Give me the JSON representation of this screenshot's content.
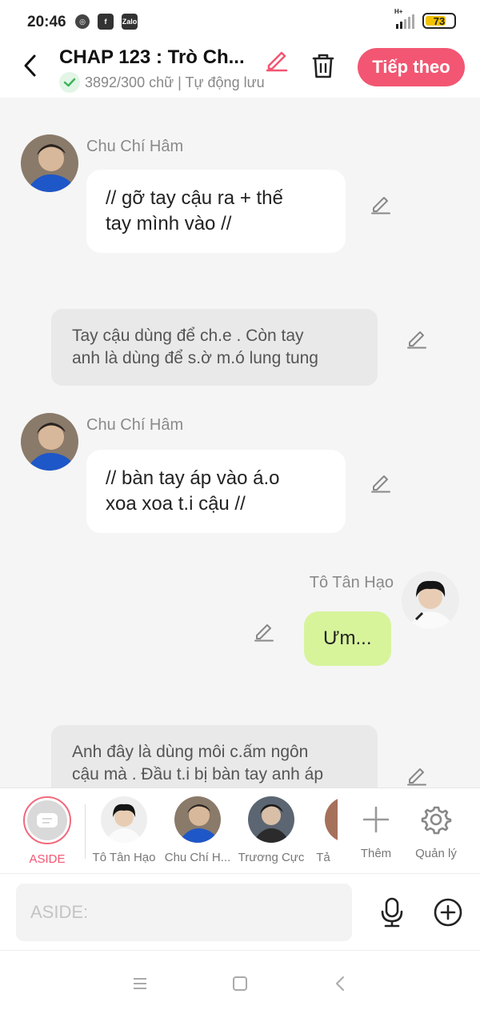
{
  "status_bar": {
    "time": "20:46",
    "network": "H+",
    "battery": "73",
    "battery_level": 0.73,
    "app_icons": [
      "target-icon",
      "facebook-icon",
      "zalo-icon"
    ]
  },
  "header": {
    "title": "CHAP 123 : Trò Ch...",
    "word_count": "3892/300 chữ | Tự động lưu",
    "next_label": "Tiếp theo",
    "accent": "#f25672"
  },
  "messages": [
    {
      "type": "left",
      "sender": "Chu Chí Hâm",
      "text_lines": [
        "// gỡ tay cậu ra + thế",
        "tay mình vào //"
      ]
    },
    {
      "type": "aside",
      "text_lines": [
        "Tay cậu dùng để ch.e . Còn tay",
        "anh là dùng để s.ờ m.ó lung tung"
      ]
    },
    {
      "type": "left",
      "sender": "Chu Chí Hâm",
      "text_lines": [
        "// bàn tay áp vào á.o",
        "xoa xoa t.i cậu //"
      ]
    },
    {
      "type": "right",
      "sender": "Tô Tân Hạo",
      "text_lines": [
        "Ưm..."
      ]
    },
    {
      "type": "aside",
      "text_lines": [
        "Anh đây là dùng môi c.ấm ngôn",
        "cậu mà . Đầu t.i bị bàn tay anh áp"
      ]
    }
  ],
  "characters": {
    "aside_label": "ASIDE",
    "items": [
      {
        "label": "Tô Tân Hạo"
      },
      {
        "label": "Chu Chí H..."
      },
      {
        "label": "Trương Cực"
      },
      {
        "label": "Tả"
      }
    ],
    "add_label": "Thêm",
    "manage_label": "Quản lý"
  },
  "input": {
    "placeholder": "ASIDE:"
  }
}
